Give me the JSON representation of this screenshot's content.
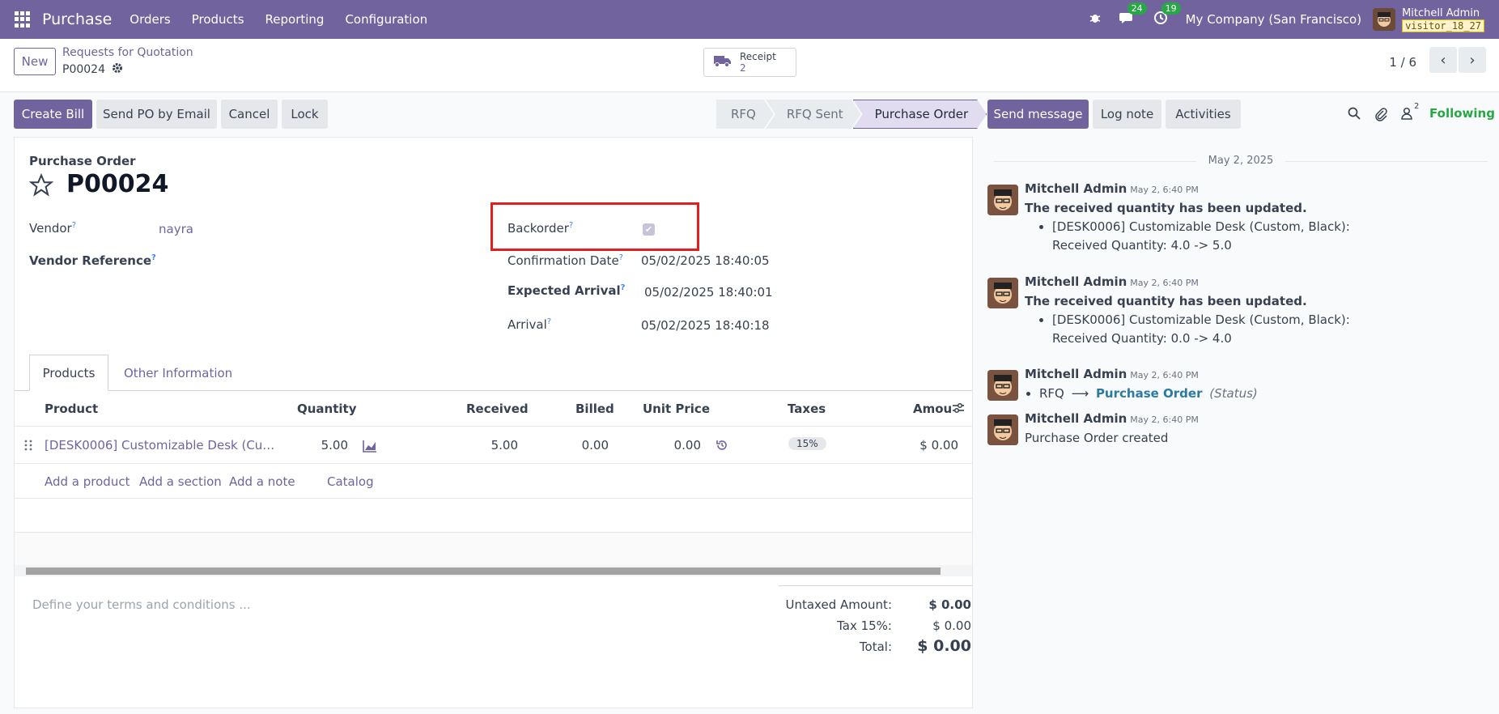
{
  "navbar": {
    "app_name": "Purchase",
    "menu": [
      "Orders",
      "Products",
      "Reporting",
      "Configuration"
    ],
    "messages_badge": "24",
    "activities_badge": "19",
    "company": "My Company (San Francisco)",
    "user_name": "Mitchell Admin",
    "db_name": "visitor_18_27",
    "accent_color": "#71639e"
  },
  "controlbar": {
    "new_label": "New",
    "breadcrumb_parent": "Requests for Quotation",
    "breadcrumb_current": "P00024",
    "receipt_label": "Receipt",
    "receipt_count": "2",
    "pager": "1 / 6"
  },
  "actions": {
    "create_bill": "Create Bill",
    "send_po": "Send PO by Email",
    "cancel": "Cancel",
    "lock": "Lock"
  },
  "status_stages": [
    "RFQ",
    "RFQ Sent",
    "Purchase Order"
  ],
  "active_stage": "Purchase Order",
  "form": {
    "doc_type": "Purchase Order",
    "doc_number": "P00024",
    "vendor_label": "Vendor",
    "vendor_value": "nayra",
    "vendor_ref_label": "Vendor Reference",
    "backorder_label": "Backorder",
    "backorder_checked": true,
    "confirmation_label": "Confirmation Date",
    "confirmation_value": "05/02/2025 18:40:05",
    "expected_label": "Expected Arrival",
    "expected_value": "05/02/2025 18:40:01",
    "arrival_label": "Arrival",
    "arrival_value": "05/02/2025 18:40:18"
  },
  "tabs": [
    "Products",
    "Other Information"
  ],
  "table": {
    "headers": [
      "Product",
      "Quantity",
      "Received",
      "Billed",
      "Unit Price",
      "Taxes",
      "Amou"
    ],
    "rows": [
      {
        "product": "[DESK0006] Customizable Desk (Cu…",
        "quantity": "5.00",
        "received": "5.00",
        "billed": "0.00",
        "unit_price": "0.00",
        "taxes": "15%",
        "amount": "$ 0.00"
      }
    ],
    "add_links": [
      "Add a product",
      "Add a section",
      "Add a note",
      "Catalog"
    ]
  },
  "terms_placeholder": "Define your terms and conditions ...",
  "totals": {
    "untaxed_label": "Untaxed Amount:",
    "untaxed_value": "$ 0.00",
    "tax_label": "Tax 15%:",
    "tax_value": "$ 0.00",
    "total_label": "Total:",
    "total_value": "$ 0.00"
  },
  "chatter": {
    "send_message": "Send message",
    "log_note": "Log note",
    "activities": "Activities",
    "followers_count": "2",
    "following": "Following",
    "date_separator": "May 2, 2025",
    "messages": [
      {
        "author": "Mitchell Admin",
        "date": "May 2, 6:40 PM",
        "title": "The received quantity has been updated.",
        "line1": "[DESK0006] Customizable Desk (Custom, Black):",
        "line2": "Received Quantity: 4.0 -> 5.0"
      },
      {
        "author": "Mitchell Admin",
        "date": "May 2, 6:40 PM",
        "title": "The received quantity has been updated.",
        "line1": "[DESK0006] Customizable Desk (Custom, Black):",
        "line2": "Received Quantity: 0.0 -> 4.0"
      },
      {
        "author": "Mitchell Admin",
        "date": "May 2, 6:40 PM",
        "from": "RFQ",
        "to": "Purchase Order",
        "field": "(Status)"
      },
      {
        "author": "Mitchell Admin",
        "date": "May 2, 6:40 PM",
        "body": "Purchase Order created"
      }
    ]
  }
}
